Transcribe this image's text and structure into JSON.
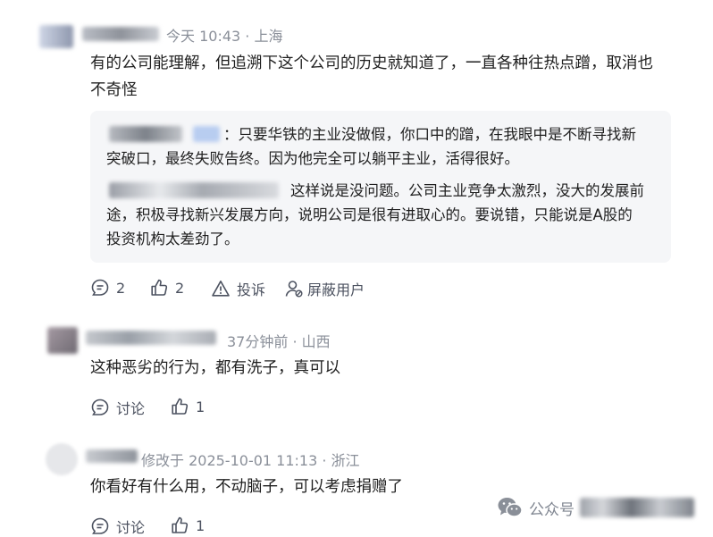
{
  "comments": [
    {
      "meta": "今天 10:43 · 上海",
      "text_lines": [
        "有的公司能理解，但追溯下这个公司的历史就知道了，一直各种往热点蹭，取消也",
        "不奇怪"
      ],
      "replies": [
        {
          "lines": [
            "：只要华铁的主业没做假，你口中的蹭，在我眼中是不断寻找新",
            "突破口，最终失败告终。因为他完全可以躺平主业，活得很好。"
          ]
        },
        {
          "lines": [
            "这样说是没问题。公司主业竞争太激烈，没大的发展前",
            "途，积极寻找新兴发展方向，说明公司是很有进取心的。要说错，只能说是A股的",
            "投资机构太差劲了。"
          ]
        }
      ],
      "actions": {
        "reply_count": "2",
        "like_count": "2",
        "report_label": "投诉",
        "block_label": "屏蔽用户"
      }
    },
    {
      "meta": "37分钟前 · 山西",
      "text": "这种恶劣的行为，都有洗子，真可以",
      "actions": {
        "discuss_label": "讨论",
        "like_count": "1"
      }
    },
    {
      "meta": "修改于 2025-10-01 11:13 · 浙江",
      "text": "你看好有什么用，不动脑子，可以考虑捐赠了",
      "actions": {
        "discuss_label": "讨论",
        "like_count": "1"
      }
    }
  ],
  "watermark": {
    "label": "公众号",
    "icon": "wechat-icon"
  },
  "icons": [
    "comment-icon",
    "like-icon",
    "warning-icon",
    "block-user-icon",
    "wechat-icon"
  ],
  "colors": {
    "meta_text": "#8a8f99",
    "action_text": "#4c5260",
    "quote_bg": "#f5f6f8"
  }
}
